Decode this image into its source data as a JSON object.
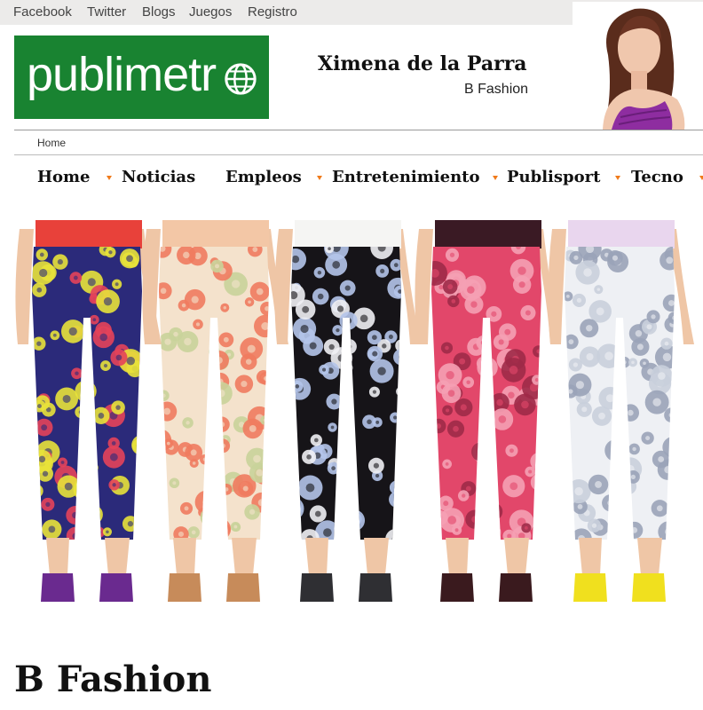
{
  "top_links": [
    "Facebook",
    "Twitter",
    "Blogs",
    "Juegos",
    "Registro"
  ],
  "logo": {
    "text": "publimetr"
  },
  "author": {
    "name": "Ximena de la Parra",
    "blog": "B Fashion"
  },
  "breadcrumb": "Home",
  "nav": [
    "Home",
    "Noticias",
    "Empleos",
    "Entretenimiento",
    "Publisport",
    "Tecno"
  ],
  "hero": {
    "description": "five pairs of floral print trousers",
    "pants": [
      {
        "name": "navy-floral",
        "base": "#2b2a7a",
        "flower": "#e8e23a",
        "accent": "#e4435a",
        "top": "#e8413a",
        "shoe": "#6a2a8f"
      },
      {
        "name": "peach-floral",
        "base": "#f4e2cc",
        "flower": "#ef7b5f",
        "accent": "#c9d39a",
        "top": "#f3c7a6",
        "shoe": "#c78b5a"
      },
      {
        "name": "black-floral",
        "base": "#161418",
        "flower": "#b4c4ea",
        "accent": "#f0f0f4",
        "top": "#f5f5f3",
        "shoe": "#2f2f33"
      },
      {
        "name": "pink-floral",
        "base": "#e2476a",
        "flower": "#f5a0b4",
        "accent": "#9e2a48",
        "top": "#3a1a24",
        "shoe": "#3a1a1e"
      },
      {
        "name": "grey-print",
        "base": "#eef0f4",
        "flower": "#9aa3b8",
        "accent": "#c9cfdc",
        "top": "#e9d6ee",
        "shoe": "#f0e01e"
      }
    ]
  },
  "article": {
    "title": "B Fashion"
  },
  "colors": {
    "brand_green": "#198331",
    "nav_bullet": "#f07a1a",
    "topbar": "#ecebea"
  }
}
